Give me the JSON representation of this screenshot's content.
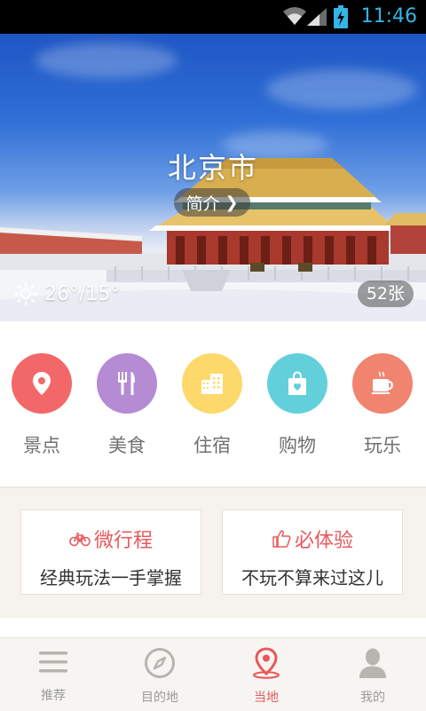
{
  "status_bar": {
    "time": "11:46",
    "icons": [
      "wifi-icon",
      "signal-icon",
      "battery-charging-icon"
    ]
  },
  "hero": {
    "city": "北京市",
    "intro_label": "简介",
    "weather": {
      "icon": "sun-icon",
      "temp": "26°/15°"
    },
    "photo_count": "52张"
  },
  "categories": [
    {
      "label": "景点",
      "icon": "location-pin-icon",
      "color": "#f26868"
    },
    {
      "label": "美食",
      "icon": "fork-knife-icon",
      "color": "#b58bd3"
    },
    {
      "label": "住宿",
      "icon": "building-icon",
      "color": "#fdd86b"
    },
    {
      "label": "购物",
      "icon": "shopping-bag-icon",
      "color": "#62d0db"
    },
    {
      "label": "玩乐",
      "icon": "coffee-cup-icon",
      "color": "#f0846f"
    }
  ],
  "features": [
    {
      "title": "微行程",
      "icon": "bicycle-icon",
      "subtitle": "经典玩法一手掌握"
    },
    {
      "title": "必体验",
      "icon": "thumbs-up-icon",
      "subtitle": "不玩不算来过这儿"
    }
  ],
  "nav": [
    {
      "label": "推荐",
      "icon": "menu-lines-icon",
      "active": false
    },
    {
      "label": "目的地",
      "icon": "compass-icon",
      "active": false
    },
    {
      "label": "当地",
      "icon": "map-pin-icon",
      "active": true
    },
    {
      "label": "我的",
      "icon": "user-icon",
      "active": false
    }
  ],
  "colors": {
    "accent": "#e9585a",
    "status_text": "#33b5e5"
  }
}
